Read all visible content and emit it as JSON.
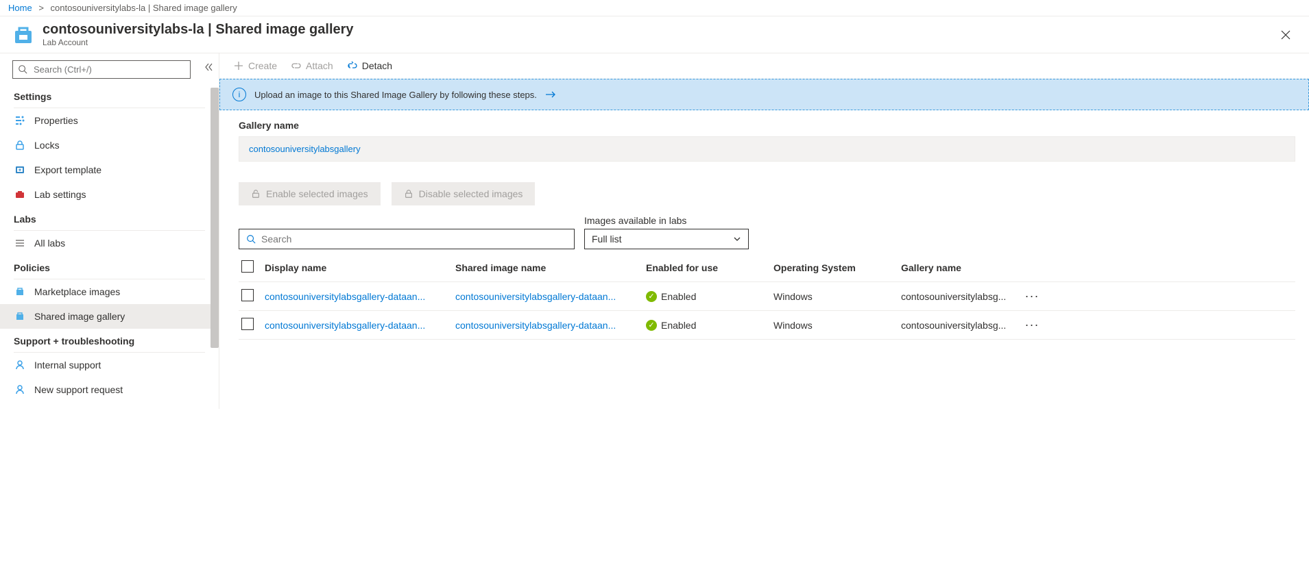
{
  "breadcrumb": {
    "home": "Home",
    "current": "contosouniversitylabs-la | Shared image gallery"
  },
  "header": {
    "title": "contosouniversitylabs-la | Shared image gallery",
    "subtitle": "Lab Account"
  },
  "sidebar": {
    "search_placeholder": "Search (Ctrl+/)",
    "sections": {
      "settings": "Settings",
      "labs": "Labs",
      "policies": "Policies",
      "support": "Support + troubleshooting"
    },
    "items": {
      "properties": "Properties",
      "locks": "Locks",
      "export_template": "Export template",
      "lab_settings": "Lab settings",
      "all_labs": "All labs",
      "marketplace_images": "Marketplace images",
      "shared_image_gallery": "Shared image gallery",
      "internal_support": "Internal support",
      "new_support_request": "New support request"
    }
  },
  "toolbar": {
    "create": "Create",
    "attach": "Attach",
    "detach": "Detach"
  },
  "banner": {
    "text": "Upload an image to this Shared Image Gallery by following these steps."
  },
  "gallery": {
    "label": "Gallery name",
    "name": "contosouniversitylabsgallery"
  },
  "pills": {
    "enable": "Enable selected images",
    "disable": "Disable selected images"
  },
  "search_placeholder_main": "Search",
  "dropdown": {
    "label": "Images available in labs",
    "value": "Full list"
  },
  "columns": {
    "display": "Display name",
    "shared": "Shared image name",
    "enabled": "Enabled for use",
    "os": "Operating System",
    "gallery": "Gallery name"
  },
  "rows": [
    {
      "display": "contosouniversitylabsgallery-dataan...",
      "shared": "contosouniversitylabsgallery-dataan...",
      "enabled": "Enabled",
      "os": "Windows",
      "gallery": "contosouniversitylabsg..."
    },
    {
      "display": "contosouniversitylabsgallery-dataan...",
      "shared": "contosouniversitylabsgallery-dataan...",
      "enabled": "Enabled",
      "os": "Windows",
      "gallery": "contosouniversitylabsg..."
    }
  ]
}
